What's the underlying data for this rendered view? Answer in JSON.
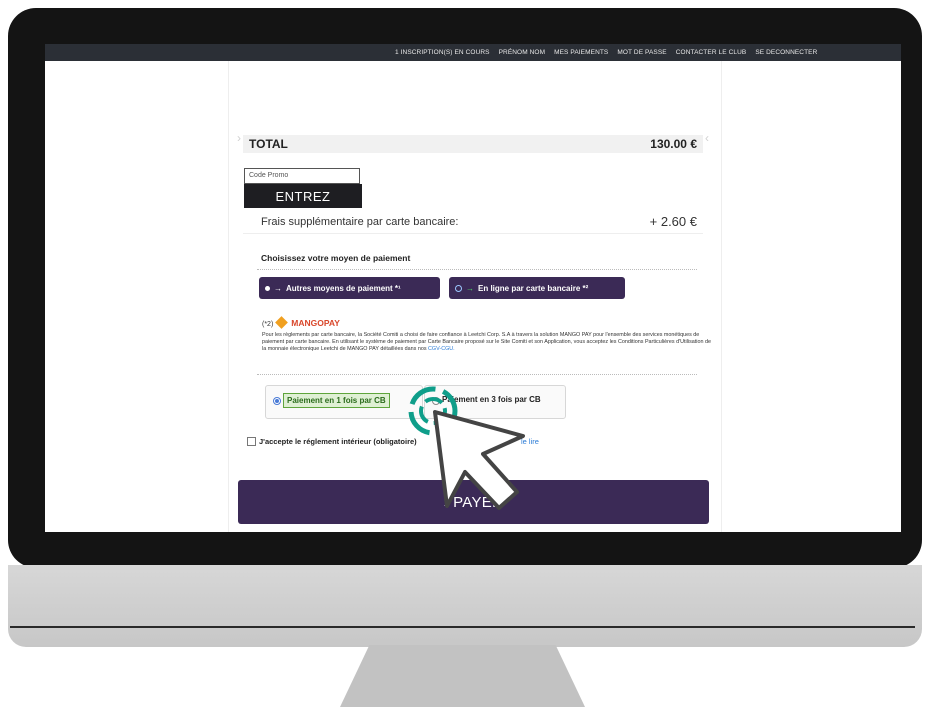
{
  "nav": {
    "items": [
      "1 INSCRIPTION(S) EN COURS",
      "PRÉNOM NOM",
      "MES PAIEMENTS",
      "MOT DE PASSE",
      "CONTACTER LE CLUB",
      "SE DECONNECTER"
    ]
  },
  "total": {
    "label": "TOTAL",
    "value": "130.00 €"
  },
  "promo": {
    "placeholder": "Code Promo",
    "button": "ENTREZ"
  },
  "fees": {
    "label": "Frais supplémentaire par carte bancaire:",
    "value": "+ 2.60 €"
  },
  "payment": {
    "heading": "Choisissez votre moyen de paiement",
    "options": [
      {
        "label": "Autres moyens de paiement *¹"
      },
      {
        "label": "En ligne par carte bancaire *²"
      }
    ]
  },
  "mangopay": {
    "prefix": "(*2)",
    "logo": "MANGOPAY",
    "text": "Pour les règlements par carte bancaire, la Société Comiti a choisi de faire confiance à Leetchi Corp. S.A à travers la solution MANGO PAY pour l'ensemble des services monétiques de paiement par carte bancaire. En utilisant le système de paiement par Carte Bancaire proposé sur le Site Comiti et son Application, vous acceptez les Conditions Particulières d'Utilisation de la monnaie électronique Leetchi de MANGO PAY détaillées dans nos",
    "link": "CGV-CGU."
  },
  "installments": {
    "option1": "Paiement en 1 fois par CB",
    "option2": "Paiement en 3 fois par CB"
  },
  "accept": {
    "label": "J'accepte le réglement intérieur (obligatoire)",
    "link": "le lire"
  },
  "payer": {
    "label": "PAYER",
    "icon": "chevron-right-icon"
  },
  "colors": {
    "brand": "#3b2a56",
    "accent": "#2a7bd6",
    "cursor_ring": "#0f9e8a"
  }
}
